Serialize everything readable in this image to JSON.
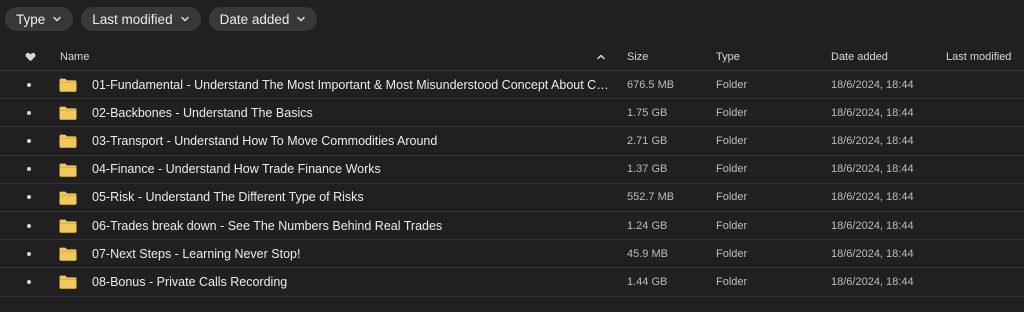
{
  "filters": {
    "type_label": "Type",
    "last_modified_label": "Last modified",
    "date_added_label": "Date added"
  },
  "columns": {
    "name": "Name",
    "size": "Size",
    "type": "Type",
    "date_added": "Date added",
    "last_modified": "Last modified"
  },
  "rows": [
    {
      "name": "01-Fundamental - Understand The Most Important & Most Misunderstood Concept About Co...",
      "size": "676.5 MB",
      "type": "Folder",
      "date_added": "18/6/2024, 18:44",
      "last_modified": ""
    },
    {
      "name": "02-Backbones - Understand The Basics",
      "size": "1.75 GB",
      "type": "Folder",
      "date_added": "18/6/2024, 18:44",
      "last_modified": ""
    },
    {
      "name": "03-Transport - Understand How To Move Commodities Around",
      "size": "2.71 GB",
      "type": "Folder",
      "date_added": "18/6/2024, 18:44",
      "last_modified": ""
    },
    {
      "name": "04-Finance - Understand How Trade Finance Works",
      "size": "1.37 GB",
      "type": "Folder",
      "date_added": "18/6/2024, 18:44",
      "last_modified": ""
    },
    {
      "name": "05-Risk - Understand The Different Type of Risks",
      "size": "552.7 MB",
      "type": "Folder",
      "date_added": "18/6/2024, 18:44",
      "last_modified": ""
    },
    {
      "name": "06-Trades break down - See The Numbers Behind Real Trades",
      "size": "1.24 GB",
      "type": "Folder",
      "date_added": "18/6/2024, 18:44",
      "last_modified": ""
    },
    {
      "name": "07-Next Steps - Learning Never Stop!",
      "size": "45.9 MB",
      "type": "Folder",
      "date_added": "18/6/2024, 18:44",
      "last_modified": ""
    },
    {
      "name": "08-Bonus - Private Calls Recording",
      "size": "1.44 GB",
      "type": "Folder",
      "date_added": "18/6/2024, 18:44",
      "last_modified": ""
    }
  ],
  "colors": {
    "background": "#202020",
    "chip": "#383838",
    "folder": "#f2c85b"
  }
}
